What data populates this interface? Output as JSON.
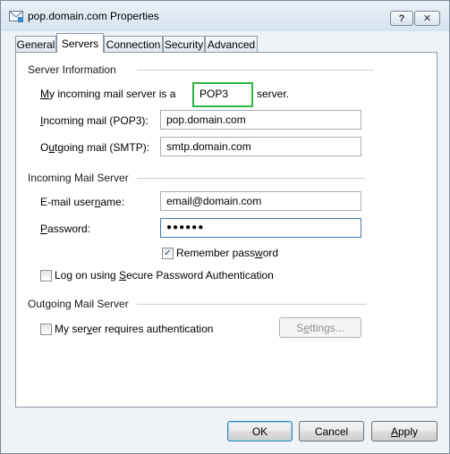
{
  "window": {
    "title": "pop.domain.com Properties"
  },
  "title_buttons": {
    "help": "?",
    "close": "✕"
  },
  "tabs": [
    {
      "label": "General"
    },
    {
      "label": "Servers"
    },
    {
      "label": "Connection"
    },
    {
      "label": "Security"
    },
    {
      "label": "Advanced"
    }
  ],
  "server_info": {
    "heading": "Server Information",
    "incoming_type_prefix": "y incoming mail server is a",
    "incoming_type_mnemonic": "M",
    "incoming_type_value": "POP3",
    "incoming_type_suffix": "server.",
    "incoming_mail_label": "Incoming mail (POP3):",
    "incoming_mail_mnemonic": "I",
    "incoming_mail_rest": "ncoming mail (POP3):",
    "incoming_mail_value": "pop.domain.com",
    "outgoing_mail_mnemonic": "u",
    "outgoing_mail_pre": "O",
    "outgoing_mail_rest": "tgoing mail (SMTP):",
    "outgoing_mail_value": "smtp.domain.com"
  },
  "incoming_server": {
    "heading": "Incoming Mail Server",
    "username_pre": "E-mail user",
    "username_mnemonic": "n",
    "username_post": "ame:",
    "username_value": "email@domain.com",
    "password_mnemonic": "P",
    "password_rest": "assword:",
    "password_value": "●●●●●●",
    "remember_pre": "Remember pass",
    "remember_mnemonic": "w",
    "remember_post": "ord",
    "remember_checked": "✓",
    "spa_pre": "Log on using ",
    "spa_mnemonic": "S",
    "spa_post": "ecure Password Authentication"
  },
  "outgoing_server": {
    "heading": "Outgoing Mail Server",
    "auth_pre": "My ser",
    "auth_mnemonic": "v",
    "auth_post": "er requires authentication",
    "settings_pre": "S",
    "settings_mnemonic": "e",
    "settings_post": "ttings..."
  },
  "buttons": {
    "ok": "OK",
    "cancel": "Cancel",
    "apply_mnemonic": "A",
    "apply_rest": "pply"
  },
  "colors": {
    "highlight": "#2fb441",
    "accent": "#3c7fb1"
  }
}
